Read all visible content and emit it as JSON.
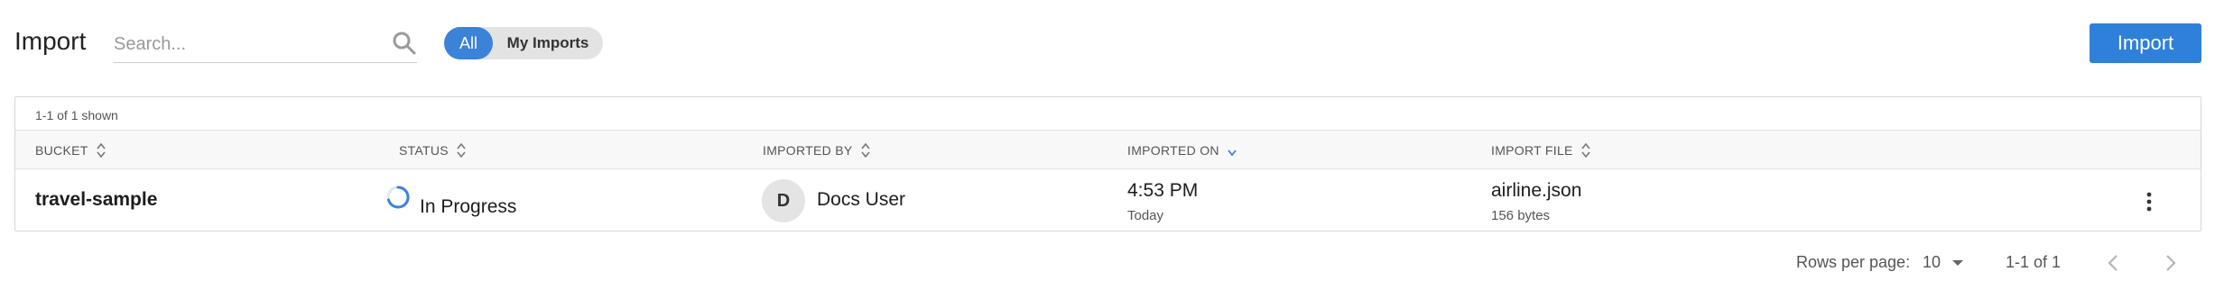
{
  "header": {
    "title": "Import",
    "search_placeholder": "Search...",
    "filters": {
      "all": "All",
      "mine": "My Imports",
      "selected": "All"
    },
    "import_button": "Import"
  },
  "table": {
    "shown_text": "1-1 of 1 shown",
    "columns": {
      "bucket": "BUCKET",
      "status": "STATUS",
      "imported_by": "IMPORTED BY",
      "imported_on": "IMPORTED ON",
      "import_file": "IMPORT FILE"
    },
    "sorted_column": "imported_on",
    "rows": [
      {
        "bucket": "travel-sample",
        "status": "In Progress",
        "user_initial": "D",
        "user_name": "Docs User",
        "time": "4:53 PM",
        "date": "Today",
        "file": "airline.json",
        "size": "156 bytes"
      }
    ]
  },
  "pagination": {
    "rows_per_page_label": "Rows per page:",
    "rows_per_page": "10",
    "range": "1-1 of 1"
  },
  "colors": {
    "accent": "#3b82d9",
    "primary_button": "#2f80d9"
  },
  "icons": {
    "search": "search-icon",
    "sort": "sort-icon",
    "sort_desc": "sort-desc-icon",
    "spinner": "spinner-icon",
    "kebab": "more-vertical-icon",
    "prev": "chevron-left-icon",
    "next": "chevron-right-icon"
  }
}
